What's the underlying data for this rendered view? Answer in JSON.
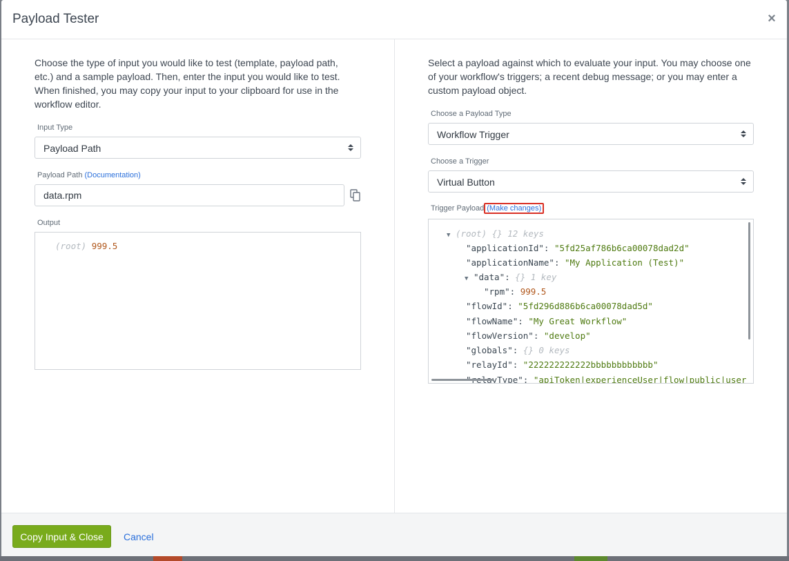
{
  "modal": {
    "title": "Payload Tester",
    "close_label": "×"
  },
  "left": {
    "intro": "Choose the type of input you would like to test (template, payload path, etc.) and a sample payload. Then, enter the input you would like to test. When finished, you may copy your input to your clipboard for use in the workflow editor.",
    "input_type_label": "Input Type",
    "input_type_value": "Payload Path",
    "payload_path_label": "Payload Path",
    "documentation_link": "(Documentation)",
    "payload_path_value": "data.rpm",
    "output_label": "Output",
    "output": {
      "root_label": "(root)",
      "root_value": "999.5"
    }
  },
  "right": {
    "intro": "Select a payload against which to evaluate your input. You may choose one of your workflow's triggers; a recent debug message; or you may enter a custom payload object.",
    "payload_type_label": "Choose a Payload Type",
    "payload_type_value": "Workflow Trigger",
    "trigger_label": "Choose a Trigger",
    "trigger_value": "Virtual Button",
    "trigger_payload_label": "Trigger Payload",
    "make_changes_link": "(Make changes)",
    "tree": {
      "root_label": "(root)",
      "root_meta": "{}  12 keys",
      "rows": [
        {
          "key": "\"applicationId\"",
          "value": "\"5fd25af786b6ca00078dad2d\"",
          "kind": "str"
        },
        {
          "key": "\"applicationName\"",
          "value": "\"My Application (Test)\"",
          "kind": "str"
        },
        {
          "key": "\"data\"",
          "value": "{}  1 key",
          "kind": "meta"
        },
        {
          "key": "\"rpm\"",
          "value": "999.5",
          "kind": "num"
        },
        {
          "key": "\"flowId\"",
          "value": "\"5fd296d886b6ca00078dad5d\"",
          "kind": "str"
        },
        {
          "key": "\"flowName\"",
          "value": "\"My Great Workflow\"",
          "kind": "str"
        },
        {
          "key": "\"flowVersion\"",
          "value": "\"develop\"",
          "kind": "str"
        },
        {
          "key": "\"globals\"",
          "value": "{}  0 keys",
          "kind": "meta"
        },
        {
          "key": "\"relayId\"",
          "value": "\"222222222222bbbbbbbbbbbb\"",
          "kind": "str"
        },
        {
          "key": "\"relayType\"",
          "value": "\"apiToken|experienceUser|flow|public|user",
          "kind": "str"
        }
      ]
    }
  },
  "footer": {
    "primary_label": "Copy Input & Close",
    "cancel_label": "Cancel"
  }
}
